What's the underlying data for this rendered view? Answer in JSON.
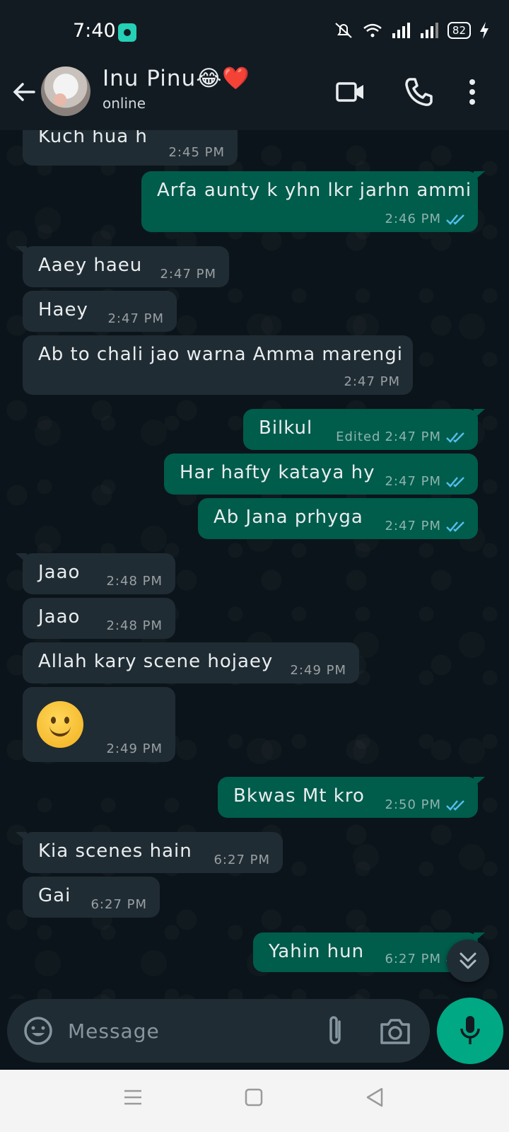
{
  "status_bar": {
    "time": "7:40",
    "battery": "82"
  },
  "header": {
    "contact_name": "Inu Pinu😂❤️",
    "contact_status": "online"
  },
  "messages": [
    {
      "dir": "in",
      "text": "Kuch hua h",
      "time": "2:45 PM"
    },
    {
      "dir": "out",
      "text": "Arfa aunty k yhn lkr jarhn ammi",
      "time": "2:46 PM"
    },
    {
      "dir": "in",
      "text": "Aaey haeu",
      "time": "2:47 PM"
    },
    {
      "dir": "in",
      "text": "Haey",
      "time": "2:47 PM"
    },
    {
      "dir": "in",
      "text": "Ab to chali jao warna Amma marengi",
      "time": "2:47 PM"
    },
    {
      "dir": "out",
      "text": "Bilkul",
      "edited": "Edited",
      "time": "2:47 PM"
    },
    {
      "dir": "out",
      "text": "Har hafty kataya hy",
      "time": "2:47 PM"
    },
    {
      "dir": "out",
      "text": "Ab Jana prhyga",
      "time": "2:47 PM"
    },
    {
      "dir": "in",
      "text": "Jaao",
      "time": "2:48 PM"
    },
    {
      "dir": "in",
      "text": "Jaao",
      "time": "2:48 PM"
    },
    {
      "dir": "in",
      "text": "Allah kary scene hojaey",
      "time": "2:49 PM"
    },
    {
      "dir": "in",
      "text": "",
      "emoji": "slightly-smiling-face",
      "time": "2:49 PM"
    },
    {
      "dir": "out",
      "text": "Bkwas Mt kro",
      "time": "2:50 PM"
    },
    {
      "dir": "in",
      "text": "Kia scenes hain",
      "time": "6:27 PM"
    },
    {
      "dir": "in",
      "text": "Gai",
      "time": "6:27 PM"
    },
    {
      "dir": "out",
      "text": "Yahin hun",
      "time": "6:27 PM"
    }
  ],
  "composer": {
    "placeholder": "Message"
  },
  "colors": {
    "incoming": "#202c33",
    "outgoing": "#005c4b",
    "accent": "#00a884",
    "read_tick": "#53bdeb"
  }
}
